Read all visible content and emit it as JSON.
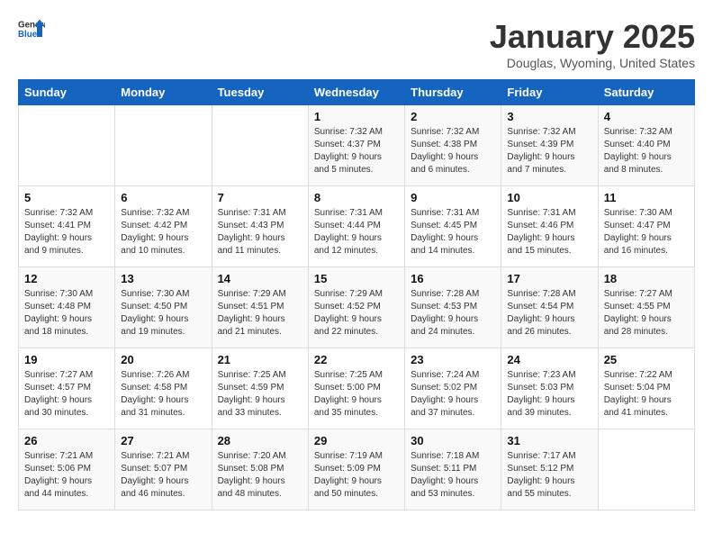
{
  "logo": {
    "text_general": "General",
    "text_blue": "Blue"
  },
  "title": "January 2025",
  "subtitle": "Douglas, Wyoming, United States",
  "headers": [
    "Sunday",
    "Monday",
    "Tuesday",
    "Wednesday",
    "Thursday",
    "Friday",
    "Saturday"
  ],
  "weeks": [
    [
      {
        "day": "",
        "info": ""
      },
      {
        "day": "",
        "info": ""
      },
      {
        "day": "",
        "info": ""
      },
      {
        "day": "1",
        "info": "Sunrise: 7:32 AM\nSunset: 4:37 PM\nDaylight: 9 hours\nand 5 minutes."
      },
      {
        "day": "2",
        "info": "Sunrise: 7:32 AM\nSunset: 4:38 PM\nDaylight: 9 hours\nand 6 minutes."
      },
      {
        "day": "3",
        "info": "Sunrise: 7:32 AM\nSunset: 4:39 PM\nDaylight: 9 hours\nand 7 minutes."
      },
      {
        "day": "4",
        "info": "Sunrise: 7:32 AM\nSunset: 4:40 PM\nDaylight: 9 hours\nand 8 minutes."
      }
    ],
    [
      {
        "day": "5",
        "info": "Sunrise: 7:32 AM\nSunset: 4:41 PM\nDaylight: 9 hours\nand 9 minutes."
      },
      {
        "day": "6",
        "info": "Sunrise: 7:32 AM\nSunset: 4:42 PM\nDaylight: 9 hours\nand 10 minutes."
      },
      {
        "day": "7",
        "info": "Sunrise: 7:31 AM\nSunset: 4:43 PM\nDaylight: 9 hours\nand 11 minutes."
      },
      {
        "day": "8",
        "info": "Sunrise: 7:31 AM\nSunset: 4:44 PM\nDaylight: 9 hours\nand 12 minutes."
      },
      {
        "day": "9",
        "info": "Sunrise: 7:31 AM\nSunset: 4:45 PM\nDaylight: 9 hours\nand 14 minutes."
      },
      {
        "day": "10",
        "info": "Sunrise: 7:31 AM\nSunset: 4:46 PM\nDaylight: 9 hours\nand 15 minutes."
      },
      {
        "day": "11",
        "info": "Sunrise: 7:30 AM\nSunset: 4:47 PM\nDaylight: 9 hours\nand 16 minutes."
      }
    ],
    [
      {
        "day": "12",
        "info": "Sunrise: 7:30 AM\nSunset: 4:48 PM\nDaylight: 9 hours\nand 18 minutes."
      },
      {
        "day": "13",
        "info": "Sunrise: 7:30 AM\nSunset: 4:50 PM\nDaylight: 9 hours\nand 19 minutes."
      },
      {
        "day": "14",
        "info": "Sunrise: 7:29 AM\nSunset: 4:51 PM\nDaylight: 9 hours\nand 21 minutes."
      },
      {
        "day": "15",
        "info": "Sunrise: 7:29 AM\nSunset: 4:52 PM\nDaylight: 9 hours\nand 22 minutes."
      },
      {
        "day": "16",
        "info": "Sunrise: 7:28 AM\nSunset: 4:53 PM\nDaylight: 9 hours\nand 24 minutes."
      },
      {
        "day": "17",
        "info": "Sunrise: 7:28 AM\nSunset: 4:54 PM\nDaylight: 9 hours\nand 26 minutes."
      },
      {
        "day": "18",
        "info": "Sunrise: 7:27 AM\nSunset: 4:55 PM\nDaylight: 9 hours\nand 28 minutes."
      }
    ],
    [
      {
        "day": "19",
        "info": "Sunrise: 7:27 AM\nSunset: 4:57 PM\nDaylight: 9 hours\nand 30 minutes."
      },
      {
        "day": "20",
        "info": "Sunrise: 7:26 AM\nSunset: 4:58 PM\nDaylight: 9 hours\nand 31 minutes."
      },
      {
        "day": "21",
        "info": "Sunrise: 7:25 AM\nSunset: 4:59 PM\nDaylight: 9 hours\nand 33 minutes."
      },
      {
        "day": "22",
        "info": "Sunrise: 7:25 AM\nSunset: 5:00 PM\nDaylight: 9 hours\nand 35 minutes."
      },
      {
        "day": "23",
        "info": "Sunrise: 7:24 AM\nSunset: 5:02 PM\nDaylight: 9 hours\nand 37 minutes."
      },
      {
        "day": "24",
        "info": "Sunrise: 7:23 AM\nSunset: 5:03 PM\nDaylight: 9 hours\nand 39 minutes."
      },
      {
        "day": "25",
        "info": "Sunrise: 7:22 AM\nSunset: 5:04 PM\nDaylight: 9 hours\nand 41 minutes."
      }
    ],
    [
      {
        "day": "26",
        "info": "Sunrise: 7:21 AM\nSunset: 5:06 PM\nDaylight: 9 hours\nand 44 minutes."
      },
      {
        "day": "27",
        "info": "Sunrise: 7:21 AM\nSunset: 5:07 PM\nDaylight: 9 hours\nand 46 minutes."
      },
      {
        "day": "28",
        "info": "Sunrise: 7:20 AM\nSunset: 5:08 PM\nDaylight: 9 hours\nand 48 minutes."
      },
      {
        "day": "29",
        "info": "Sunrise: 7:19 AM\nSunset: 5:09 PM\nDaylight: 9 hours\nand 50 minutes."
      },
      {
        "day": "30",
        "info": "Sunrise: 7:18 AM\nSunset: 5:11 PM\nDaylight: 9 hours\nand 53 minutes."
      },
      {
        "day": "31",
        "info": "Sunrise: 7:17 AM\nSunset: 5:12 PM\nDaylight: 9 hours\nand 55 minutes."
      },
      {
        "day": "",
        "info": ""
      }
    ]
  ]
}
